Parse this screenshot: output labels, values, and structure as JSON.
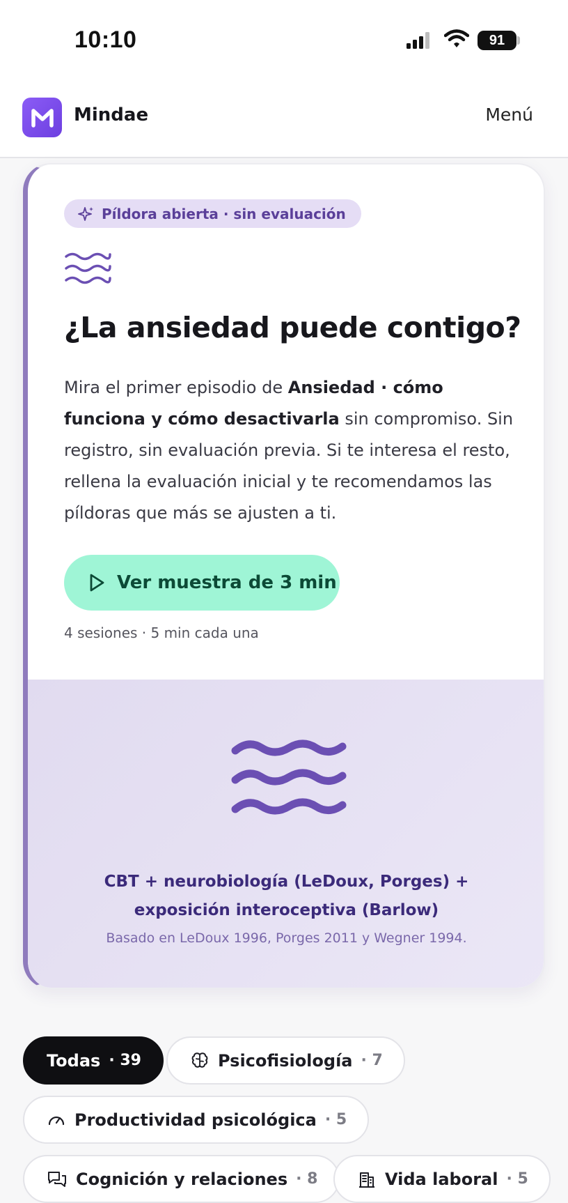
{
  "status_bar": {
    "time": "10:10",
    "battery": "91"
  },
  "header": {
    "brand": "Mindae",
    "menu_label": "Menú"
  },
  "card": {
    "tag": "Píldora abierta · sin evaluación",
    "title": "¿La ansiedad puede contigo?",
    "desc_pre": "Mira el primer episodio de ",
    "desc_bold": "Ansiedad · cómo funciona y cómo desactivarla",
    "desc_post": " sin compromiso. Sin registro, sin evaluación previa. Si te interesa el resto, rellena la evaluación inicial y te recomendamos las píldoras que más se ajusten a ti.",
    "cta_label": "Ver muestra de 3 min",
    "sessions": "4 sesiones · 5 min cada una",
    "method": "CBT + neurobiología (LeDoux, Porges) + exposición interoceptiva (Barlow)",
    "source": "Basado en LeDoux 1996, Porges 2011 y Wegner 1994."
  },
  "filters": [
    {
      "label": "Todas",
      "count": "· 39",
      "icon": "none",
      "active": true
    },
    {
      "label": "Psicofisiología",
      "count": "· 7",
      "icon": "brain-icon",
      "active": false
    },
    {
      "label": "Productividad psicológica",
      "count": "· 5",
      "icon": "gauge-icon",
      "active": false
    },
    {
      "label": "Cognición y relaciones",
      "count": "· 8",
      "icon": "chat-icon",
      "active": false
    },
    {
      "label": "Vida laboral",
      "count": "· 5",
      "icon": "building-icon",
      "active": false
    }
  ],
  "colors": {
    "accent_purple": "#6b4fb3",
    "cta_mint": "#9ff5d6",
    "card_foot": "#e4def3",
    "chip_active": "#0f0f12"
  }
}
